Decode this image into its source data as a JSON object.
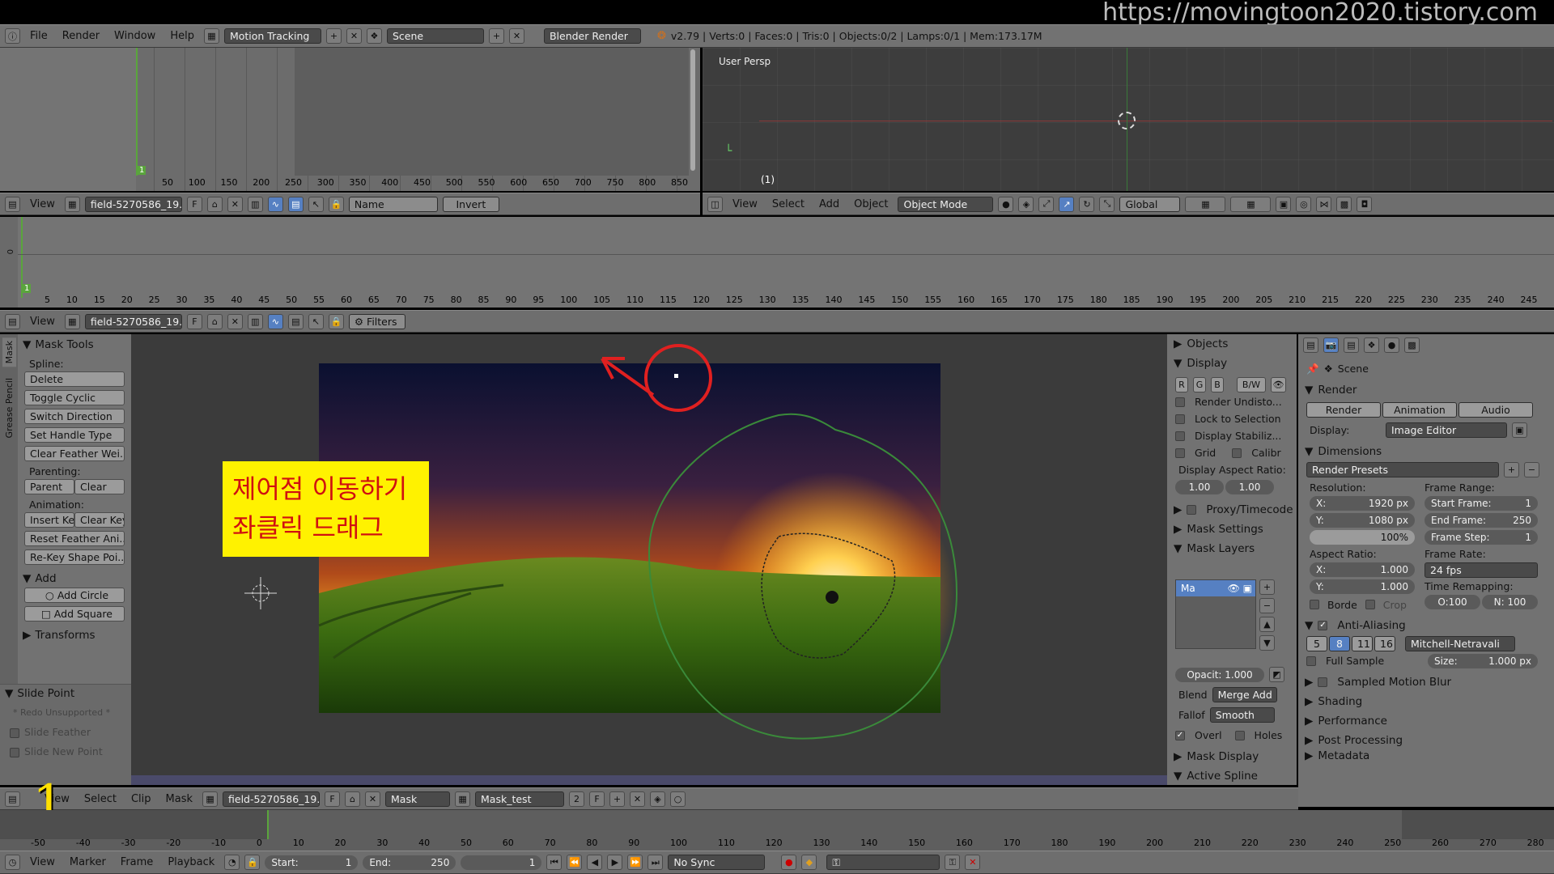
{
  "watermark": "https://movingtoon2020.tistory.com",
  "topbar": {
    "menus": [
      "File",
      "Render",
      "Window",
      "Help"
    ],
    "screen": "Motion Tracking",
    "scene": "Scene",
    "engine": "Blender Render",
    "stats": "v2.79 | Verts:0 | Faces:0 | Tris:0 | Objects:0/2 | Lamps:0/1 | Mem:173.17M"
  },
  "graph": {
    "frame_marker": "1",
    "ticks": [
      "50",
      "100",
      "150",
      "200",
      "250",
      "300",
      "350",
      "400",
      "450",
      "500",
      "550",
      "600",
      "650",
      "700",
      "750",
      "800",
      "850"
    ],
    "header": {
      "view": "View",
      "clip": "field-5270586_19...",
      "f": "F",
      "name_field": "Name",
      "invert": "Invert"
    }
  },
  "viewport3d": {
    "label": "User Persp",
    "frame": "(1)",
    "header": {
      "menus": [
        "View",
        "Select",
        "Add",
        "Object"
      ],
      "mode": "Object Mode",
      "orientation": "Global"
    }
  },
  "dopesheet": {
    "frame_marker": "1",
    "zero": "0",
    "ticks": [
      "5",
      "10",
      "15",
      "20",
      "25",
      "30",
      "35",
      "40",
      "45",
      "50",
      "55",
      "60",
      "65",
      "70",
      "75",
      "80",
      "85",
      "90",
      "95",
      "100",
      "105",
      "110",
      "115",
      "120",
      "125",
      "130",
      "135",
      "140",
      "145",
      "150",
      "155",
      "160",
      "165",
      "170",
      "175",
      "180",
      "185",
      "190",
      "195",
      "200",
      "205",
      "210",
      "215",
      "220",
      "225",
      "230",
      "235",
      "240",
      "245"
    ],
    "header": {
      "view": "View",
      "clip": "field-5270586_19...",
      "f": "F",
      "filters": "Filters"
    }
  },
  "side_tabs": [
    "Mask",
    "Grease Pencil"
  ],
  "toolshelf": {
    "mask_tools": "Mask Tools",
    "spline": "Spline:",
    "spline_buttons": [
      "Delete",
      "Toggle Cyclic",
      "Switch Direction",
      "Set Handle Type",
      "Clear Feather Wei..."
    ],
    "parenting": "Parenting:",
    "parent": "Parent",
    "clear": "Clear",
    "animation": "Animation:",
    "insert_key": "Insert Ke",
    "clear_key": "Clear Key",
    "anim_buttons": [
      "Reset Feather Ani...",
      "Re-Key Shape Poi..."
    ],
    "add": "Add",
    "add_circle": "Add Circle",
    "add_square": "Add Square",
    "transforms": "Transforms",
    "slide_point": "Slide Point",
    "redo": "* Redo Unsupported *",
    "slide_feather": "Slide Feather",
    "slide_new_point": "Slide New Point"
  },
  "annotation": {
    "line1": "제어점 이동하기",
    "line2": "좌클릭 드래그",
    "big_number": "1"
  },
  "mask_panel": {
    "objects": "Objects",
    "display": "Display",
    "rgb": [
      "R",
      "G",
      "B"
    ],
    "bw": "B/W",
    "checks": [
      "Render Undisto...",
      "Lock to Selection",
      "Display Stabiliz..."
    ],
    "grid": "Grid",
    "calibr": "Calibr",
    "aspect_label": "Display Aspect Ratio:",
    "aspect_x": "1.00",
    "aspect_y": "1.00",
    "proxy": "Proxy/Timecode",
    "mask_settings": "Mask Settings",
    "mask_layers": "Mask Layers",
    "layer_name": "Ma",
    "opacity": "Opacit: 1.000",
    "blend_label": "Blend",
    "blend": "Merge Add",
    "falloff_label": "Fallof",
    "falloff": "Smooth",
    "overlap": "Overl",
    "holes": "Holes",
    "mask_display": "Mask Display",
    "active_spline": "Active Spline"
  },
  "properties": {
    "scene": "Scene",
    "render": "Render",
    "tabs": [
      "Render",
      "Animation",
      "Audio"
    ],
    "display_label": "Display:",
    "display": "Image Editor",
    "dimensions": "Dimensions",
    "presets": "Render Presets",
    "resolution": "Resolution:",
    "res_x": "X:",
    "res_x_val": "1920 px",
    "res_y": "Y:",
    "res_y_val": "1080 px",
    "res_pct": "100%",
    "frame_range": "Frame Range:",
    "start_frame": "Start Frame:",
    "start_val": "1",
    "end_frame": "End Frame:",
    "end_val": "250",
    "frame_step": "Frame Step:",
    "step_val": "1",
    "aspect": "Aspect Ratio:",
    "asp_x": "X:",
    "asp_x_val": "1.000",
    "asp_y": "Y:",
    "asp_y_val": "1.000",
    "frame_rate": "Frame Rate:",
    "fps": "24 fps",
    "borde": "Borde",
    "crop": "Crop",
    "time_remap": "Time Remapping:",
    "old": "O:100",
    "new": "N: 100",
    "aa": "Anti-Aliasing",
    "aa_samples": [
      "5",
      "8",
      "11",
      "16"
    ],
    "aa_filter": "Mitchell-Netravali",
    "full_sample": "Full Sample",
    "size": "Size:",
    "size_val": "1.000 px",
    "sections": [
      "Sampled Motion Blur",
      "Shading",
      "Performance",
      "Post Processing",
      "Metadata"
    ]
  },
  "clip_header": {
    "menus": [
      "View",
      "Select",
      "Clip",
      "Mask"
    ],
    "clip": "field-5270586_19...",
    "f": "F",
    "mode": "Mask",
    "mask_name": "Mask_test",
    "users": "2"
  },
  "timeline": {
    "ticks": [
      "-50",
      "-40",
      "-30",
      "-20",
      "-10",
      "0",
      "10",
      "20",
      "30",
      "40",
      "50",
      "60",
      "70",
      "80",
      "90",
      "100",
      "110",
      "120",
      "130",
      "140",
      "150",
      "160",
      "170",
      "180",
      "190",
      "200",
      "210",
      "220",
      "230",
      "240",
      "250",
      "260",
      "270",
      "280"
    ],
    "header": {
      "menus": [
        "View",
        "Marker",
        "Frame",
        "Playback"
      ],
      "start": "Start:",
      "start_val": "1",
      "end": "End:",
      "end_val": "250",
      "current": "1",
      "sync": "No Sync"
    }
  }
}
